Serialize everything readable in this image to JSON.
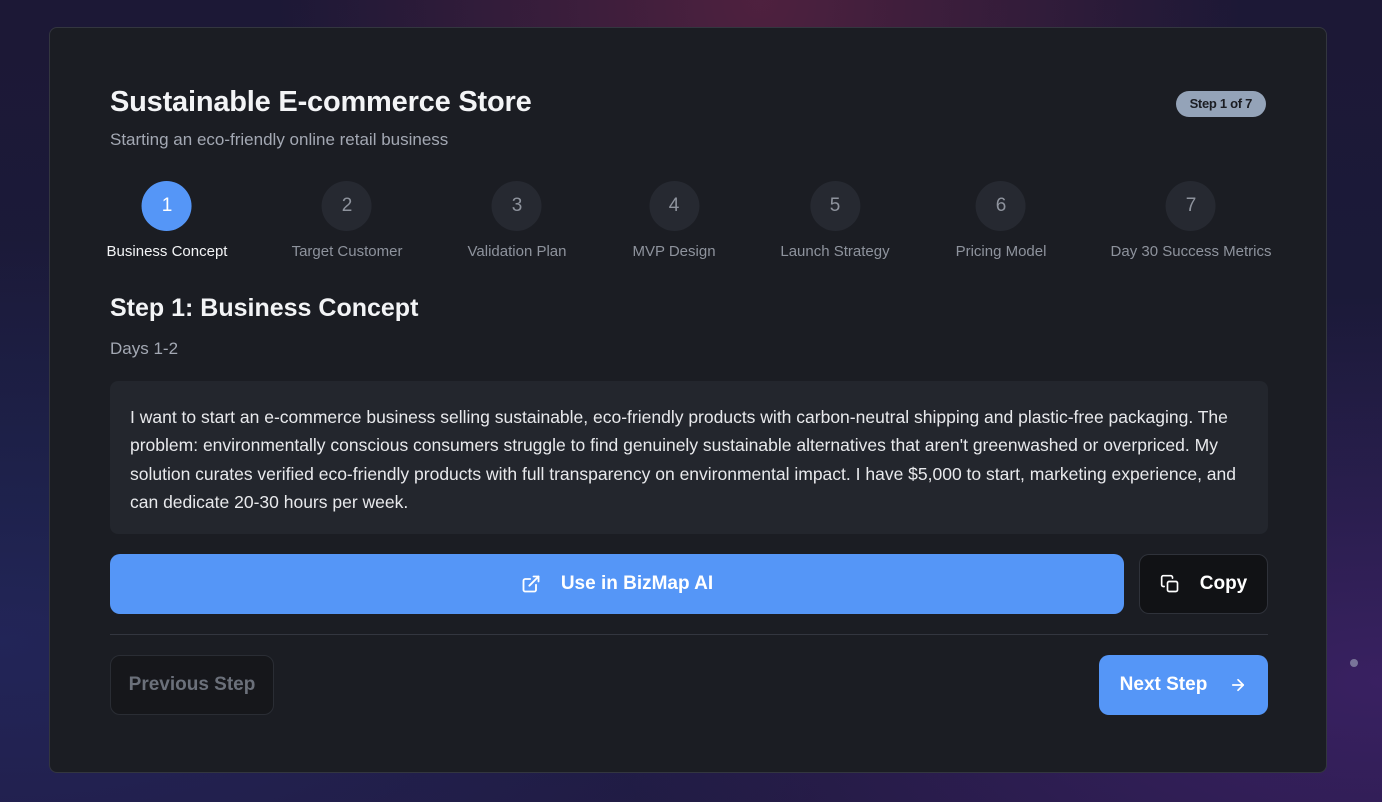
{
  "header": {
    "title": "Sustainable E-commerce Store",
    "subtitle": "Starting an eco-friendly online retail business",
    "step_badge": "Step 1 of 7"
  },
  "stepper": {
    "active_index": 0,
    "steps": [
      {
        "number": "1",
        "label": "Business Concept"
      },
      {
        "number": "2",
        "label": "Target Customer"
      },
      {
        "number": "3",
        "label": "Validation Plan"
      },
      {
        "number": "4",
        "label": "MVP Design"
      },
      {
        "number": "5",
        "label": "Launch Strategy"
      },
      {
        "number": "6",
        "label": "Pricing Model"
      },
      {
        "number": "7",
        "label": "Day 30 Success Metrics"
      }
    ]
  },
  "content": {
    "section_title": "Step 1: Business Concept",
    "days": "Days 1-2",
    "prompt_text": "I want to start an e-commerce business selling sustainable, eco-friendly products with carbon-neutral shipping and plastic-free packaging. The problem: environmentally conscious consumers struggle to find genuinely sustainable alternatives that aren't greenwashed or overpriced. My solution curates verified eco-friendly products with full transparency on environmental impact. I have $5,000 to start, marketing experience, and can dedicate 20-30 hours per week."
  },
  "actions": {
    "use_label": "Use in BizMap AI",
    "use_icon": "external-link-icon",
    "copy_label": "Copy",
    "copy_icon": "copy-icon"
  },
  "navigation": {
    "previous_label": "Previous Step",
    "next_label": "Next Step",
    "next_icon": "arrow-right-icon"
  },
  "colors": {
    "accent": "#5596f7",
    "card_bg": "#1b1d23",
    "badge_bg": "#94a3b8"
  }
}
